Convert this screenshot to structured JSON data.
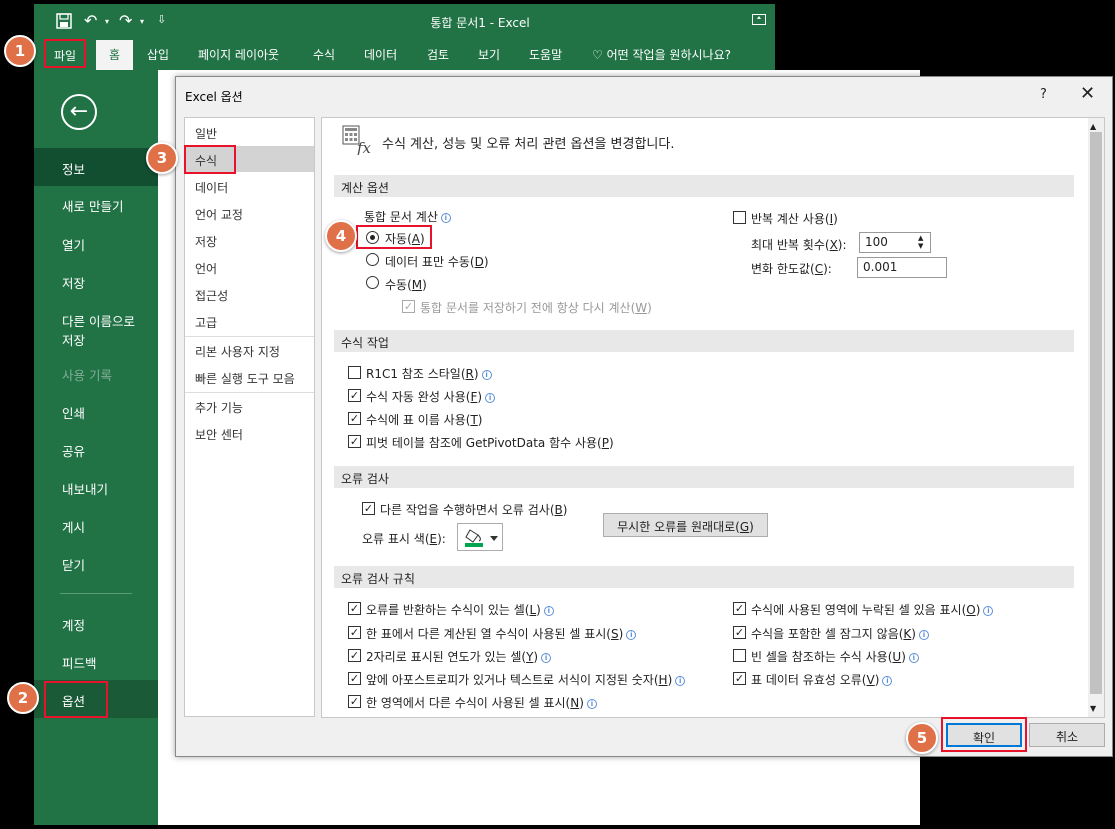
{
  "app": {
    "title": "통합 문서1  -  Excel"
  },
  "ribbon": {
    "tabs": [
      "파일",
      "홈",
      "삽입",
      "페이지 레이아웃",
      "수식",
      "데이터",
      "검토",
      "보기",
      "도움말"
    ],
    "tell_me": "어떤 작업을 원하시나요?"
  },
  "backstage": {
    "items": [
      "정보",
      "새로 만들기",
      "열기",
      "저장",
      "다른 이름으로",
      "저장",
      "사용 기록",
      "인쇄",
      "공유",
      "내보내기",
      "게시",
      "닫기",
      "계정",
      "피드백",
      "옵션"
    ]
  },
  "dialog": {
    "title": "Excel 옵션",
    "help": "?",
    "close": "✕"
  },
  "nav": {
    "items": [
      "일반",
      "수식",
      "데이터",
      "언어 교정",
      "저장",
      "언어",
      "접근성",
      "고급",
      "리본 사용자 지정",
      "빠른 실행 도구 모음",
      "추가 기능",
      "보안 센터"
    ]
  },
  "header": {
    "text": "수식 계산, 성능 및 오류 처리 관련 옵션을 변경합니다."
  },
  "calc": {
    "section": "계산 옵션",
    "workbook_calc": "통합 문서 계산",
    "auto": "자동(A)",
    "auto_a": "자동(",
    "auto_u": "A",
    "auto_except": "데이터 표만 수동(",
    "auto_except_u": "D",
    "manual": "수동(",
    "manual_u": "M",
    "recalc": "통합 문서를 저장하기 전에 항상 다시 계산(",
    "recalc_u": "W",
    "iter": "반복 계산 사용(",
    "iter_u": "I",
    "max_iter": "최대 반복 횟수(",
    "max_iter_u": "X",
    "max_iter_val": "100",
    "max_change": "변화 한도값(",
    "max_change_u": "C",
    "max_change_val": "0.001"
  },
  "formulas": {
    "section": "수식 작업",
    "r1c1": "R1C1 참조 스타일(",
    "r1c1_u": "R",
    "autocomplete": "수식 자동 완성 사용(",
    "autocomplete_u": "F",
    "tablenames": "수식에 표 이름 사용(",
    "tablenames_u": "T",
    "pivot": "피벗 테이블 참조에 GetPivotData 함수 사용(",
    "pivot_u": "P"
  },
  "errcheck": {
    "section": "오류 검사",
    "bg": "다른 작업을 수행하면서 오류 검사(",
    "bg_u": "B",
    "color": "오류 표시 색(",
    "color_u": "E",
    "reset": "무시한 오류를 원래대로(",
    "reset_u": "G"
  },
  "rules": {
    "section": "오류 검사 규칙",
    "r1": "오류를 반환하는 수식이 있는 셀(",
    "r1_u": "L",
    "r2": "한 표에서 다른 계산된 열 수식이 사용된 셀 표시(",
    "r2_u": "S",
    "r3": "2자리로 표시된 연도가 있는 셀(",
    "r3_u": "Y",
    "r4": "앞에 아포스트로피가 있거나 텍스트로 서식이 지정된 숫자(",
    "r4_u": "H",
    "r5": "한 영역에서 다른 수식이 사용된 셀 표시(",
    "r5_u": "N",
    "r6": "수식에 사용된 영역에 누락된 셀 있음 표시(",
    "r6_u": "O",
    "r7": "수식을 포함한 셀 잠그지 않음(",
    "r7_u": "K",
    "r8": "빈 셀을 참조하는 수식 사용(",
    "r8_u": "U",
    "r9": "표 데이터 유효성 오류(",
    "r9_u": "V"
  },
  "buttons": {
    "ok": "확인",
    "cancel": "취소"
  },
  "badges": [
    "1",
    "2",
    "3",
    "4",
    "5"
  ]
}
